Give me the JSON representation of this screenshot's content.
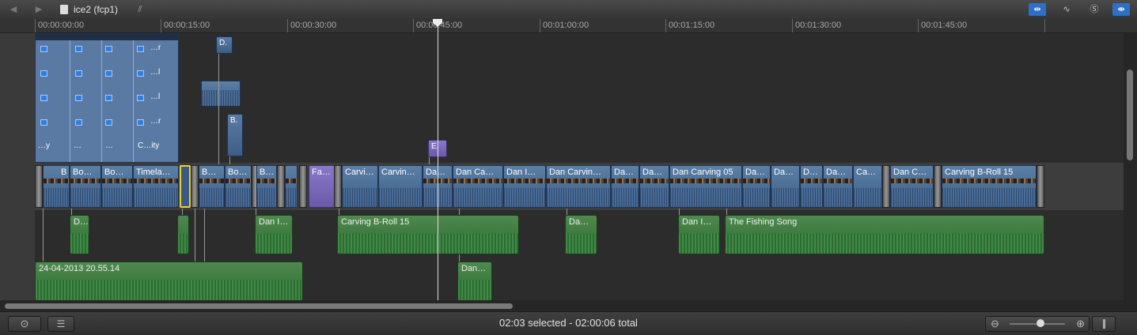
{
  "window": {
    "title": "ice2 (fcp1)"
  },
  "nav": {
    "back_icon": "◀",
    "forward_icon": "▶"
  },
  "toolbar_right": [
    {
      "name": "clip-appearance-icon",
      "glyph": "⇹"
    },
    {
      "name": "audio-waveform-icon",
      "glyph": "∿"
    },
    {
      "name": "solo-icon",
      "glyph": "Ⓢ"
    },
    {
      "name": "snapping-icon",
      "glyph": "⇼"
    }
  ],
  "ruler": {
    "labels": [
      "00:00:00:00",
      "00:00:15:00",
      "00:00:30:00",
      "00:00:45:00",
      "00:01:00:00",
      "00:01:15:00",
      "00:01:30:00",
      "00:01:45:00"
    ]
  },
  "compound": {
    "row_labels": [
      "…r",
      "…l",
      "…l",
      "…r"
    ],
    "bottom_labels": [
      "…y",
      "…",
      "…",
      "C…ity"
    ]
  },
  "connected_video": [
    {
      "label": "D."
    },
    {
      "label": "B."
    },
    {
      "label": "E."
    }
  ],
  "primary": [
    {
      "label": "B"
    },
    {
      "label": "Bo…"
    },
    {
      "label": "Bo…"
    },
    {
      "label": "Timela…"
    },
    {
      "label": "B…"
    },
    {
      "label": "Bo…"
    },
    {
      "label": "B…"
    },
    {
      "label": "Fa…"
    },
    {
      "label": "Carvi…"
    },
    {
      "label": "Carvin…"
    },
    {
      "label": "Da…"
    },
    {
      "label": "Dan Ca…"
    },
    {
      "label": "Dan I…"
    },
    {
      "label": "Dan Carvin…"
    },
    {
      "label": "Da…"
    },
    {
      "label": "Da…"
    },
    {
      "label": "Dan Carving 05"
    },
    {
      "label": "Da…"
    },
    {
      "label": "Da…"
    },
    {
      "label": "D…"
    },
    {
      "label": "Da…"
    },
    {
      "label": "Ca…"
    },
    {
      "label": "Dan C…"
    },
    {
      "label": "Carving B-Roll 15"
    }
  ],
  "audio": [
    {
      "label": "D…"
    },
    {
      "label": "Dan I…"
    },
    {
      "label": "Carving B-Roll 15"
    },
    {
      "label": "Da…"
    },
    {
      "label": "Dan I…"
    },
    {
      "label": "The Fishing Song"
    },
    {
      "label": "24-04-2013 20.55.14"
    },
    {
      "label": "Dan…"
    }
  ],
  "status": {
    "text": "02:03 selected - 02:00:06 total"
  },
  "bottom": {
    "library_icon": "⊙",
    "index_icon": "☰",
    "zoom_out_icon": "⊖",
    "zoom_in_icon": "⊕",
    "zoom_level": 0.55
  }
}
